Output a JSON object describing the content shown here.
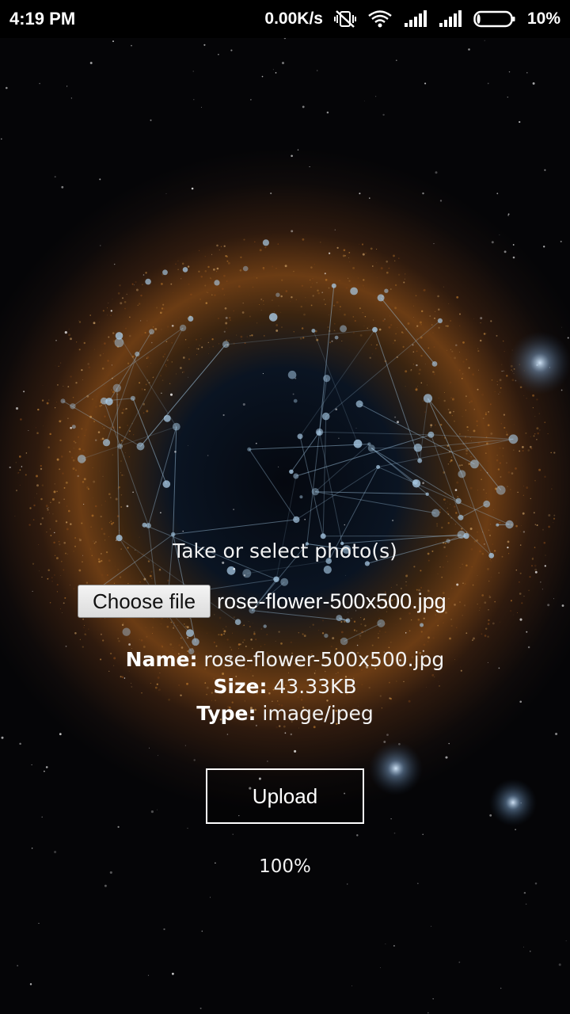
{
  "status_bar": {
    "time": "4:19 PM",
    "net_speed": "0.00K/s",
    "battery_percent": "10%",
    "battery_level": 0.1,
    "icons": [
      "mute-vibrate-icon",
      "wifi-icon",
      "signal-icon",
      "signal-icon",
      "battery-icon"
    ]
  },
  "upload_form": {
    "prompt": "Take or select photo(s)",
    "choose_file_label": "Choose file",
    "selected_file": "rose-flower-500x500.jpg",
    "name_label": "Name:",
    "name_value": "rose-flower-500x500.jpg",
    "size_label": "Size:",
    "size_value": "43.33KB",
    "type_label": "Type:",
    "type_value": "image/jpeg",
    "upload_label": "Upload",
    "progress": "100%"
  },
  "colors": {
    "background": "#000000",
    "text": "#ffffff",
    "nebula_orange": "#b5651d",
    "network_blue": "#9fc4e0"
  }
}
